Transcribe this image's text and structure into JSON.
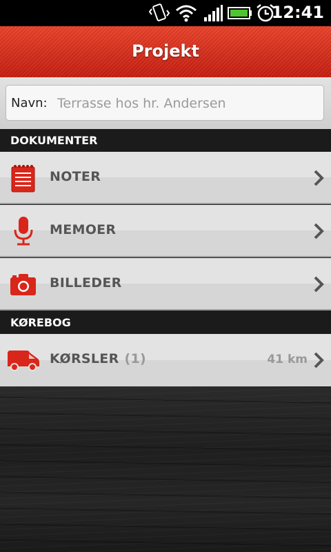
{
  "status_bar": {
    "time": "12:41"
  },
  "header": {
    "title": "Projekt"
  },
  "name_field": {
    "label": "Navn:",
    "placeholder": "Terrasse hos hr. Andersen"
  },
  "sections": {
    "documents": {
      "title": "DOKUMENTER"
    },
    "logbook": {
      "title": "KØREBOG"
    }
  },
  "documents": [
    {
      "label": "NOTER",
      "icon": "notepad-icon"
    },
    {
      "label": "MEMOER",
      "icon": "microphone-icon"
    },
    {
      "label": "BILLEDER",
      "icon": "camera-icon"
    }
  ],
  "logbook": {
    "label": "KØRSLER",
    "count": "(1)",
    "distance": "41 km",
    "icon": "van-icon"
  },
  "colors": {
    "accent_red": "#d62a16",
    "section_bg": "#1b1b1b",
    "row_text": "#555555"
  }
}
